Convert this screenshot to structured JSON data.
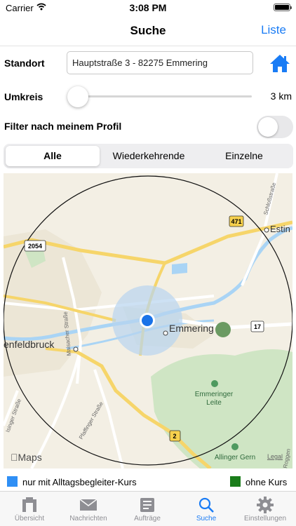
{
  "status_bar": {
    "carrier": "Carrier",
    "time": "3:08 PM"
  },
  "nav": {
    "title": "Suche",
    "right_button": "Liste"
  },
  "location": {
    "label": "Standort",
    "value": "Hauptstraße 3 - 82275 Emmering",
    "home_icon": "home-icon"
  },
  "radius": {
    "label": "Umkreis",
    "value": "3 km",
    "level": 0.0
  },
  "profile_filter": {
    "label": "Filter nach meinem Profil",
    "enabled": false
  },
  "segments": {
    "items": [
      "Alle",
      "Wiederkehrende",
      "Einzelne"
    ],
    "selected": 0
  },
  "map": {
    "places": {
      "emmering": "Emmering",
      "fuerstenfeldbruck": "enfeldbruck",
      "estin": "Estin",
      "leite": "Emmeringer",
      "leite2": "Leite",
      "allinger": "Allinger Gern",
      "roggen": "Roggen"
    },
    "streets": {
      "maisacher": "Maisacher Straße",
      "pfaffinger": "Pfaffinger Straße",
      "schloss": "Schloßstraße",
      "ising": "Isinger Straße"
    },
    "road_badges": {
      "r471": "471",
      "r2054": "2054",
      "r17": "17",
      "r2": "2"
    },
    "logo": "Maps",
    "legal": "Legal"
  },
  "legend": {
    "items": [
      {
        "label": "nur mit Alltagsbegleiter-Kurs",
        "color": "#2f8ff5"
      },
      {
        "label": "ohne Kurs",
        "color": "#1a7d1a"
      }
    ]
  },
  "tabbar": {
    "items": [
      {
        "label": "Übersicht",
        "icon": "overview-icon"
      },
      {
        "label": "Nachrichten",
        "icon": "envelope-icon"
      },
      {
        "label": "Aufträge",
        "icon": "list-icon"
      },
      {
        "label": "Suche",
        "icon": "search-icon"
      },
      {
        "label": "Einstellungen",
        "icon": "gear-icon"
      }
    ],
    "selected": 3
  },
  "colors": {
    "accent": "#1a7cf5",
    "location_dot": "#1a73e8",
    "marker_green": "#6b9a62"
  }
}
